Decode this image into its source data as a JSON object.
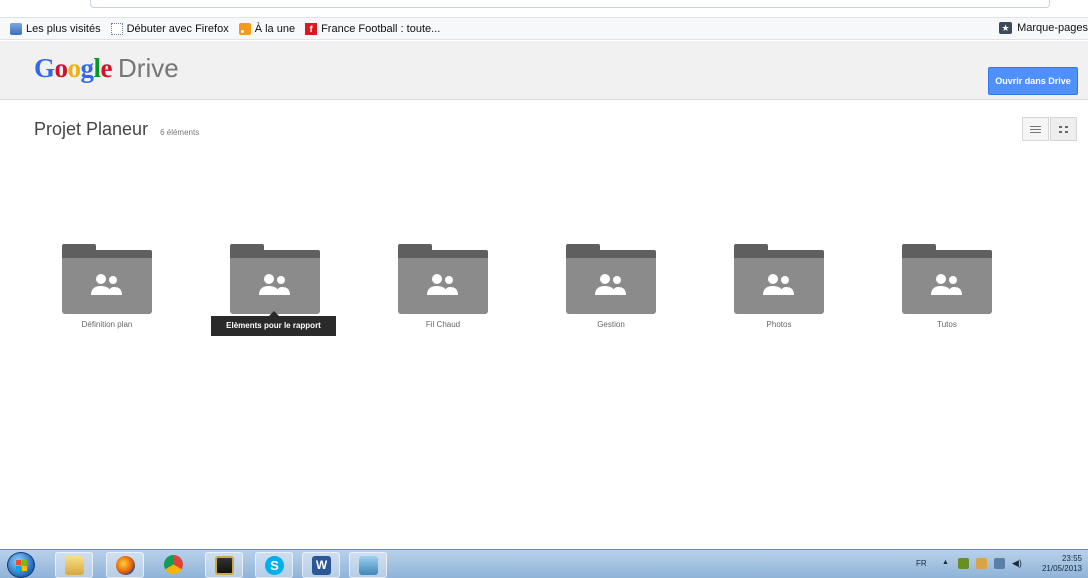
{
  "bookmarks": {
    "items": [
      {
        "label": "Les plus visités",
        "icon": "bookmark-page-icon"
      },
      {
        "label": "Débuter avec Firefox",
        "icon": "dotted-page-icon"
      },
      {
        "label": "À la une",
        "icon": "rss-icon"
      },
      {
        "label": "France Football : toute...",
        "icon": "france-football-icon"
      }
    ],
    "right_label": "Marque-pages"
  },
  "header": {
    "logo_google": "Google",
    "logo_drive": "Drive",
    "open_button": "Ouvrir dans Drive"
  },
  "folder_view": {
    "title": "Projet Planeur",
    "count": "6 éléments",
    "folders": [
      {
        "name": "Définition plan"
      },
      {
        "name": "Elèments pour le rapport"
      },
      {
        "name": "Fil Chaud"
      },
      {
        "name": "Gestion"
      },
      {
        "name": "Photos"
      },
      {
        "name": "Tutos"
      }
    ],
    "tooltip": "Elèments pour le rapport"
  },
  "taskbar": {
    "language": "FR",
    "time": "23:55",
    "date": "21/05/2013",
    "apps": [
      "windows-explorer",
      "firefox",
      "chrome",
      "movie-studio",
      "skype",
      "word",
      "image-viewer"
    ]
  },
  "colors": {
    "drive_blue": "#4d90fe",
    "folder_gray": "#8b8b8b",
    "folder_dark": "#5f5f5f",
    "tooltip_bg": "#2a2a2a"
  }
}
